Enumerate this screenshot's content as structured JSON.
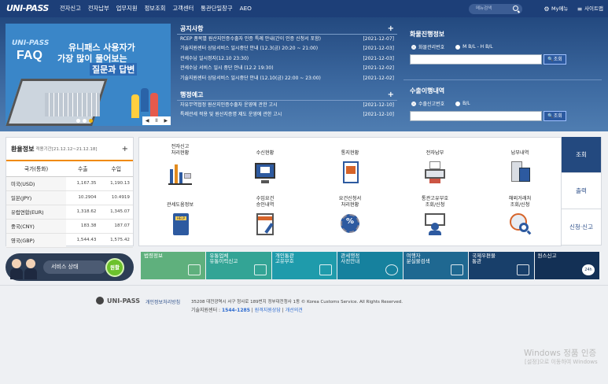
{
  "header": {
    "logo": "UNI-PASS",
    "nav": [
      "전자신고",
      "전자납부",
      "업무지원",
      "정보조회",
      "고객센터",
      "통관단일창구",
      "AEO"
    ],
    "search_placeholder": "메뉴검색",
    "my_menu": "My메뉴",
    "sitemap": "사이트맵"
  },
  "banner": {
    "brand": "UNI-PASS",
    "faq": "FAQ",
    "line1": "유니패스 사용자가",
    "line2a": "가장 많이 물어보는",
    "line3": "질문과 답변",
    "controls": [
      "◀",
      "II",
      "▶"
    ]
  },
  "notices": {
    "title": "공지사항",
    "items": [
      {
        "text": "RCEP 품목별 원산지인증수출자 인증 특례 안내(간이 인증 신청서 포함)",
        "date": "[2021-12-07]"
      },
      {
        "text": "기술지원센터 상담서비스 일시중단 안내 (12.3(금) 20:20 ~ 21:00)",
        "date": "[2021-12-03]"
      },
      {
        "text": "관세수납 일시정지(12.10 23:30)",
        "date": "[2021-12-03]"
      },
      {
        "text": "관세수납 서비스 일시 중단 안내 (12.2 19:30)",
        "date": "[2021-12-02]"
      },
      {
        "text": "기술지원센터 상담서비스 일시중단 안내 (12.10(금) 22:00 ~ 23:00)",
        "date": "[2021-12-02]"
      }
    ]
  },
  "admin": {
    "title": "행정예고",
    "items": [
      {
        "text": "자유무역협정 원산지인증수출자 운영에 관한 고시",
        "date": "[2021-12-10]"
      },
      {
        "text": "특례관세 적용 및 원산지증명 제도 운영에 관한 고시",
        "date": "[2021-12-10]"
      }
    ]
  },
  "cargo": {
    "title": "화물진행정보",
    "opt1": "화물관리번호",
    "opt2": "M B/L - H B/L",
    "btn": "조회"
  },
  "export": {
    "title": "수출이행내역",
    "opt1": "수출신고번호",
    "opt2": "B/L",
    "btn": "조회"
  },
  "fx": {
    "title": "환율정보",
    "period": "적용기간[21.12.12~21.12.18]",
    "headers": [
      "국가(통화)",
      "수출",
      "수입"
    ],
    "rows": [
      [
        "미국(USD)",
        "1,167.35",
        "1,190.13"
      ],
      [
        "일본(JPY)",
        "10.2904",
        "10.4919"
      ],
      [
        "유럽연합(EUR)",
        "1,318.62",
        "1,345.07"
      ],
      [
        "중국(CNY)",
        "183.38",
        "187.07"
      ],
      [
        "영국(GBP)",
        "1,544.43",
        "1,575.42"
      ]
    ]
  },
  "service": {
    "label": "서비스 상태",
    "status": "원활"
  },
  "grid": [
    {
      "l1": "전자신고",
      "l2": "처리현황"
    },
    {
      "l1": "",
      "l2": "수신현황"
    },
    {
      "l1": "",
      "l2": "통지현황"
    },
    {
      "l1": "",
      "l2": "전자납부"
    },
    {
      "l1": "",
      "l2": "납부내역"
    },
    {
      "l1": "",
      "l2": "관세도움정보"
    },
    {
      "l1": "수입요건",
      "l2": "승인내역"
    },
    {
      "l1": "요건신청서",
      "l2": "처리현황"
    },
    {
      "l1": "통관고유부호",
      "l2": "조회/신청"
    },
    {
      "l1": "해외거래처",
      "l2": "조회/신청"
    }
  ],
  "tabs": [
    "조회",
    "출력",
    "신청·신고"
  ],
  "quick": [
    {
      "l1": "법령정보",
      "l2": "",
      "color": "#5fb07d"
    },
    {
      "l1": "유통업체",
      "l2": "유통이력신고",
      "color": "#33a495"
    },
    {
      "l1": "개인통관",
      "l2": "고유부호",
      "color": "#1f9bab"
    },
    {
      "l1": "관세행정",
      "l2": "사전안내",
      "color": "#16819e"
    },
    {
      "l1": "여행자",
      "l2": "분실물검색",
      "color": "#1f6891"
    },
    {
      "l1": "국제우편물",
      "l2": "통관",
      "color": "#183f6a"
    },
    {
      "l1": "원스신고",
      "l2": "",
      "color": "#133055"
    }
  ],
  "footer": {
    "brand": "UNI-PASS",
    "privacy": "개인정보처리방침",
    "address": "35208 대전광역시 서구 청사로 189번지 정부대전청사 1동 © Korea Customs Service. All Rights Reserved.",
    "help_label": "기술지원센터 :",
    "help_phone": "1544-1285",
    "remote": "원격지원상담",
    "opinion": "개선의견"
  },
  "watermark": {
    "line1": "Windows 정품 인증",
    "line2": "[설정]으로 이동하여 Windows"
  },
  "colors": {
    "navy": "#1d3f78",
    "accent": "#f08a00",
    "green": "#6cc12c"
  }
}
